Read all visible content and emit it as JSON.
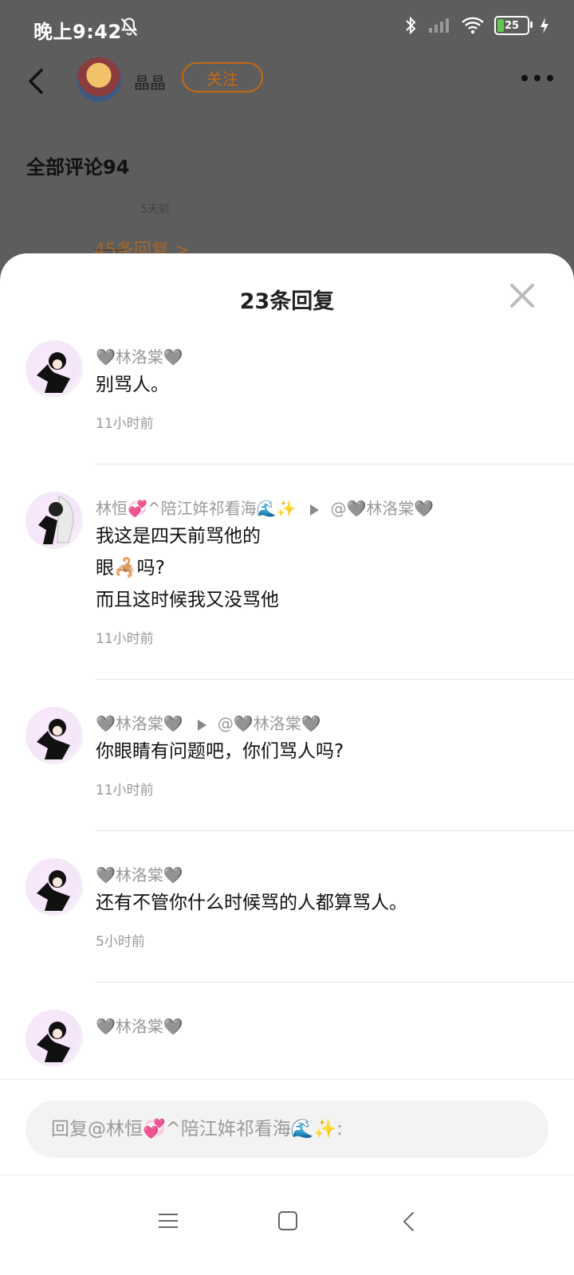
{
  "status": {
    "time": "晚上9:42",
    "battery": "25"
  },
  "header": {
    "username": "晶晶",
    "follow_label": "关注"
  },
  "all_comments": "全部评论94",
  "background_hint": {
    "time_fragment": "5天前",
    "replies_link": "45条回复 >"
  },
  "sheet": {
    "title": "23条回复"
  },
  "replies": [
    {
      "name": "🩶林洛棠🩶",
      "target": "",
      "lines": [
        "别骂人。"
      ],
      "time": "11小时前"
    },
    {
      "name": "林恒💞^陪江姩祁看海🌊✨",
      "target": "@🩶林洛棠🩶",
      "lines": [
        "我这是四天前骂他的",
        "眼🦂吗?",
        "而且这时候我又没骂他"
      ],
      "time": "11小时前"
    },
    {
      "name": "🩶林洛棠🩶",
      "target": "@🩶林洛棠🩶",
      "lines": [
        "你眼睛有问题吧，你们骂人吗?"
      ],
      "time": "11小时前"
    },
    {
      "name": "🩶林洛棠🩶",
      "target": "",
      "lines": [
        "还有不管你什么时候骂的人都算骂人。"
      ],
      "time": "5小时前"
    },
    {
      "name": "🩶林洛棠🩶",
      "target": "",
      "lines": [],
      "time": ""
    }
  ],
  "reply_input": {
    "placeholder": "回复@林恒💞^陪江姩祁看海🌊✨:"
  }
}
